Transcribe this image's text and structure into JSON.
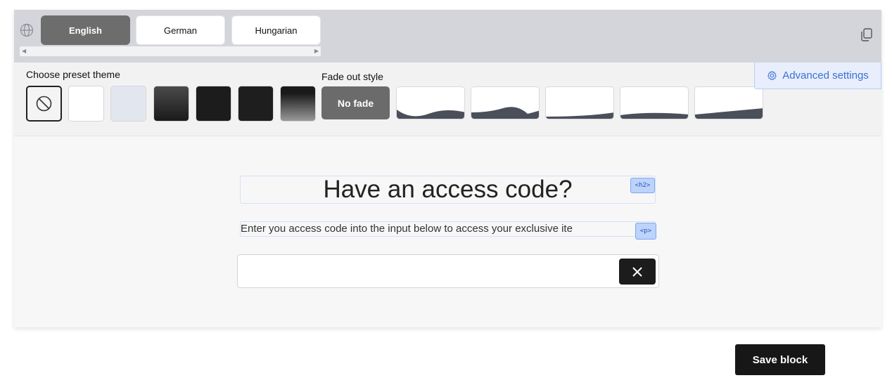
{
  "languages": {
    "tabs": [
      "English",
      "German",
      "Hungarian"
    ],
    "active": "English"
  },
  "theme_section": {
    "label": "Choose preset theme",
    "presets": [
      "none",
      "white",
      "light-gray",
      "dark-gradient",
      "black",
      "black-2",
      "black-gradient"
    ]
  },
  "fade_section": {
    "label": "Fade out style",
    "no_fade_label": "No fade",
    "options": [
      "no-fade",
      "wave-1",
      "wave-2",
      "curve-1",
      "curve-2",
      "slope"
    ]
  },
  "advanced": {
    "label": "Advanced settings"
  },
  "content": {
    "heading": "Have an access code?",
    "heading_tag": "<h2>",
    "paragraph": "Enter you access code into the input below to access your exclusive ite",
    "paragraph_tag": "<p>",
    "input_value": ""
  },
  "save_label": "Save block",
  "colors": {
    "accent": "#3b6fd8",
    "dark": "#171717",
    "tab_active": "#6d6d6d"
  }
}
